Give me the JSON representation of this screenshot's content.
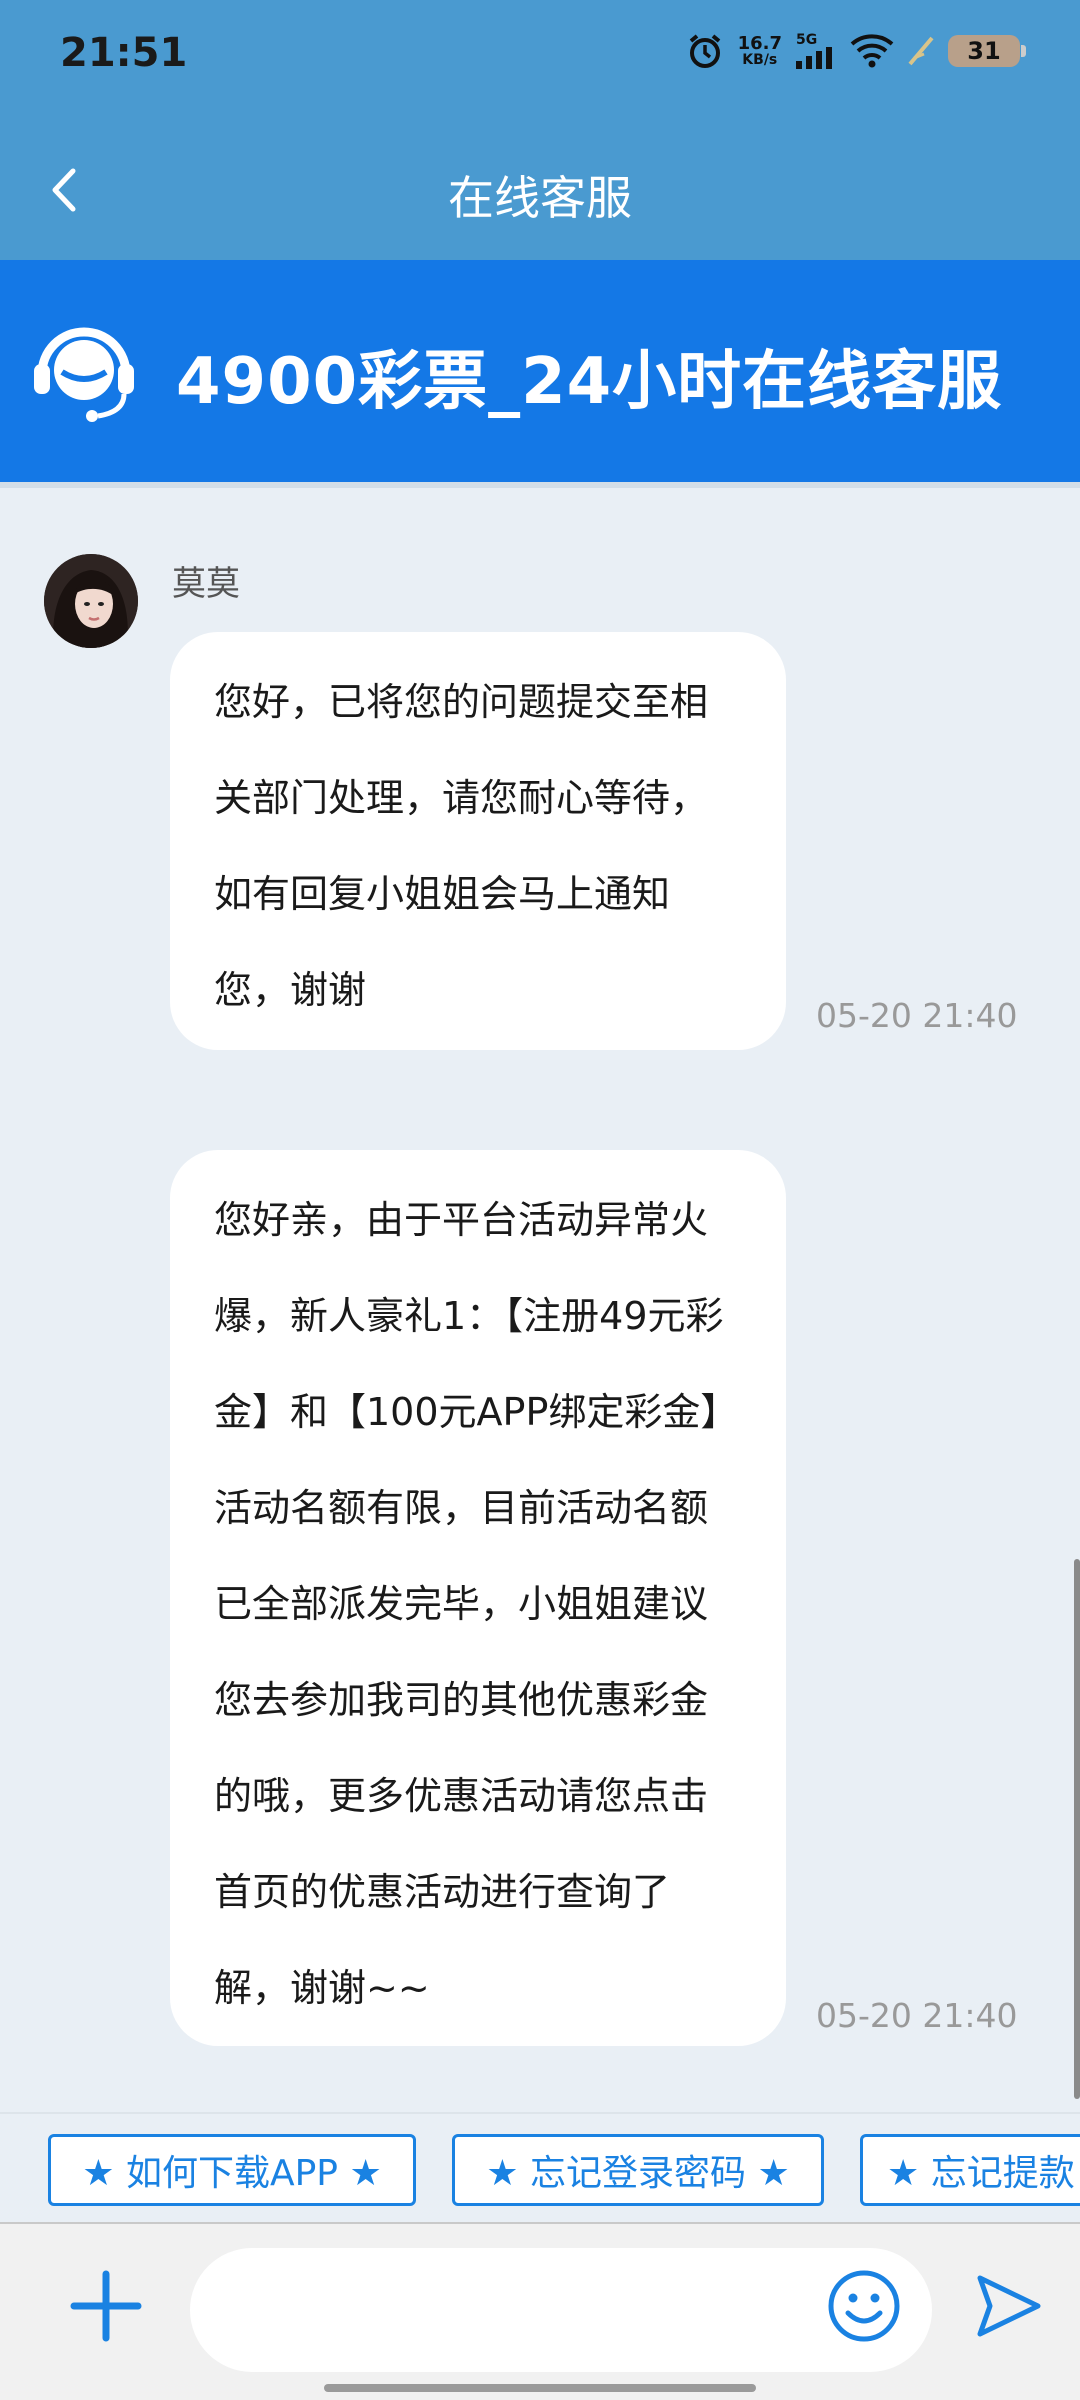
{
  "status_bar": {
    "time": "21:51",
    "net_speed_value": "16.7",
    "net_speed_unit": "KB/s",
    "network_type": "5G",
    "battery": "31",
    "icons": [
      "alarm-icon",
      "signal-icon",
      "wifi-icon",
      "charging-icon",
      "battery-icon"
    ]
  },
  "header": {
    "title": "在线客服"
  },
  "banner": {
    "text": "4900彩票_24小时在线客服",
    "icon": "headset-icon"
  },
  "chat": {
    "agent_name": "莫莫",
    "messages": [
      {
        "text": "您好，已将您的问题提交至相关部门处理，请您耐心等待，如有回复小姐姐会马上通知您，谢谢",
        "time": "05-20 21:40"
      },
      {
        "text": "您好亲，由于平台活动异常火爆，新人豪礼1：【注册49元彩金】和【100元APP绑定彩金】活动名额有限，目前活动名额已全部派发完毕，小姐姐建议您去参加我司的其他优惠彩金的哦，更多优惠活动请您点击首页的优惠活动进行查询了解，谢谢~~",
        "time": "05-20 21:40"
      }
    ]
  },
  "quick_replies": [
    {
      "label": "★ 如何下载APP ★"
    },
    {
      "label": "★ 忘记登录密码 ★"
    },
    {
      "label": "★ 忘记提款"
    }
  ],
  "input": {
    "value": "",
    "placeholder": ""
  },
  "colors": {
    "header_bg": "#4a9ad0",
    "banner_bg": "#1478e6",
    "accent": "#1a82e2",
    "chat_bg": "#e9eff5"
  }
}
